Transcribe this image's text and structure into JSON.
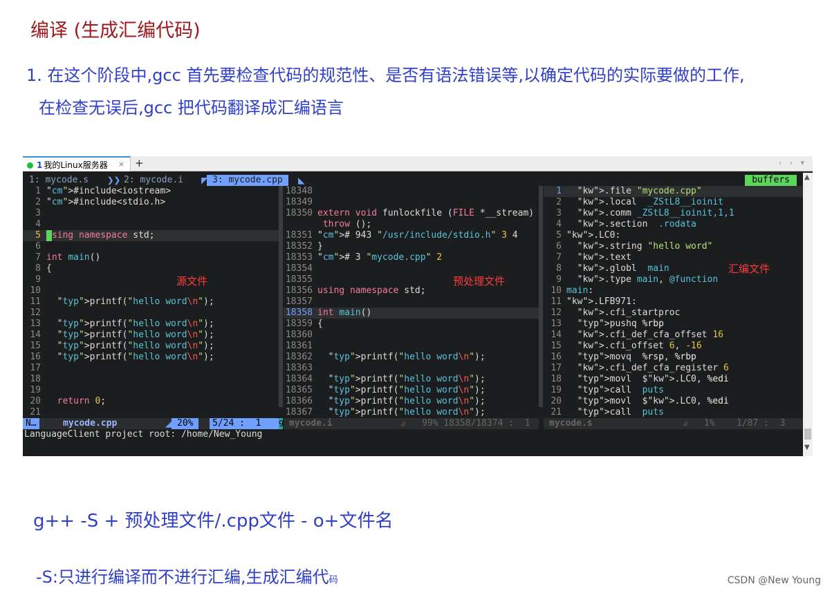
{
  "doc": {
    "title": "编译 (生成汇编代码)",
    "para1_line1": "1. 在这个阶段中,gcc 首先要检查代码的规范性、是否有语法错误等,以确定代码的实际要做的工作,",
    "para1_line2": "在检查无误后,gcc 把代码翻译成汇编语言",
    "para2": "g++ -S + 预处理文件/.cpp文件  - o+文件名",
    "para3": "-S:只进行编译而不进行汇编,生成汇编代",
    "para3_small": "码",
    "watermark": "CSDN @New  Young"
  },
  "terminal": {
    "tab_number": "1",
    "tab_label": "我的Linux服务器",
    "tab_close": "×",
    "tab_add": "+",
    "tab_arrows": "‹ › ▾",
    "buffers": [
      "1: mycode.s",
      "2: mycode.i",
      "3: mycode.cpp"
    ],
    "buffers_label": "buffers",
    "left_pane": {
      "annotation": "源文件",
      "lines": [
        {
          "n": "1",
          "t": "#include<iostream>"
        },
        {
          "n": "2",
          "t": "#include<stdio.h>"
        },
        {
          "n": "3",
          "t": ""
        },
        {
          "n": "4",
          "t": ""
        },
        {
          "n": "5",
          "t": "using namespace std;"
        },
        {
          "n": "6",
          "t": ""
        },
        {
          "n": "7",
          "t": "int main()"
        },
        {
          "n": "8",
          "t": "{"
        },
        {
          "n": "9",
          "t": ""
        },
        {
          "n": "10",
          "t": ""
        },
        {
          "n": "11",
          "t": "  printf(\"hello word\\n\");"
        },
        {
          "n": "12",
          "t": ""
        },
        {
          "n": "13",
          "t": "  printf(\"hello word\\n\");"
        },
        {
          "n": "14",
          "t": "  printf(\"hello word\\n\");"
        },
        {
          "n": "15",
          "t": "  printf(\"hello word\\n\");"
        },
        {
          "n": "16",
          "t": "  printf(\"hello word\\n\");"
        },
        {
          "n": "17",
          "t": ""
        },
        {
          "n": "18",
          "t": ""
        },
        {
          "n": "19",
          "t": ""
        },
        {
          "n": "20",
          "t": "  return 0;"
        },
        {
          "n": "21",
          "t": ""
        }
      ],
      "status_mode": "N…",
      "status_file": "mycode.cpp",
      "status_pct": "20%",
      "status_pos": "5/24 :  1",
      "status_extra": "9"
    },
    "mid_pane": {
      "annotation": "预处理文件",
      "lines": [
        {
          "n": "18348",
          "t": ""
        },
        {
          "n": "18349",
          "t": ""
        },
        {
          "n": "18350",
          "t": "extern void funlockfile (FILE *__stream)"
        },
        {
          "n": "",
          "t": " throw ();"
        },
        {
          "n": "18351",
          "t": "# 943 \"/usr/include/stdio.h\" 3 4"
        },
        {
          "n": "18352",
          "t": "}"
        },
        {
          "n": "18353",
          "t": "# 3 \"mycode.cpp\" 2"
        },
        {
          "n": "18354",
          "t": ""
        },
        {
          "n": "18355",
          "t": ""
        },
        {
          "n": "18356",
          "t": "using namespace std;"
        },
        {
          "n": "18357",
          "t": ""
        },
        {
          "n": "18358",
          "t": "int main()"
        },
        {
          "n": "18359",
          "t": "{"
        },
        {
          "n": "18360",
          "t": ""
        },
        {
          "n": "18361",
          "t": ""
        },
        {
          "n": "18362",
          "t": "  printf(\"hello word\\n\");"
        },
        {
          "n": "18363",
          "t": ""
        },
        {
          "n": "18364",
          "t": "  printf(\"hello word\\n\");"
        },
        {
          "n": "18365",
          "t": "  printf(\"hello word\\n\");"
        },
        {
          "n": "18366",
          "t": "  printf(\"hello word\\n\");"
        },
        {
          "n": "18367",
          "t": "  printf(\"hello word\\n\");"
        }
      ],
      "status_file": "mycode.i",
      "status_pos": "99% 18358/18374 :  1"
    },
    "right_pane": {
      "annotation": "汇编文件",
      "lines": [
        {
          "n": "1",
          "t": "  .file \"mycode.cpp\""
        },
        {
          "n": "2",
          "t": "  .local  _ZStL8__ioinit"
        },
        {
          "n": "3",
          "t": "  .comm _ZStL8__ioinit,1,1"
        },
        {
          "n": "4",
          "t": "  .section  .rodata"
        },
        {
          "n": "5",
          "t": ".LC0:"
        },
        {
          "n": "6",
          "t": "  .string \"hello word\""
        },
        {
          "n": "7",
          "t": "  .text"
        },
        {
          "n": "8",
          "t": "  .globl  main"
        },
        {
          "n": "9",
          "t": "  .type main, @function"
        },
        {
          "n": "10",
          "t": "main:"
        },
        {
          "n": "11",
          "t": ".LFB971:"
        },
        {
          "n": "12",
          "t": "  .cfi_startproc"
        },
        {
          "n": "13",
          "t": "  pushq %rbp"
        },
        {
          "n": "14",
          "t": "  .cfi_def_cfa_offset 16"
        },
        {
          "n": "15",
          "t": "  .cfi_offset 6, -16"
        },
        {
          "n": "16",
          "t": "  movq  %rsp, %rbp"
        },
        {
          "n": "17",
          "t": "  .cfi_def_cfa_register 6"
        },
        {
          "n": "18",
          "t": "  movl  $.LC0, %edi"
        },
        {
          "n": "19",
          "t": "  call  puts"
        },
        {
          "n": "20",
          "t": "  movl  $.LC0, %edi"
        },
        {
          "n": "21",
          "t": "  call  puts"
        }
      ],
      "status_file": "mycode.s",
      "status_pos": "1%    1/87 :  3"
    },
    "cmdline": "LanguageClient project root: /home/New_Young"
  },
  "colors": {
    "buffer_active": "#6fa0ff",
    "buffers_tag": "#5cd65c",
    "annotation": "#ff3b3b",
    "title": "#a0191d",
    "text_blue": "#2f3fc9"
  }
}
